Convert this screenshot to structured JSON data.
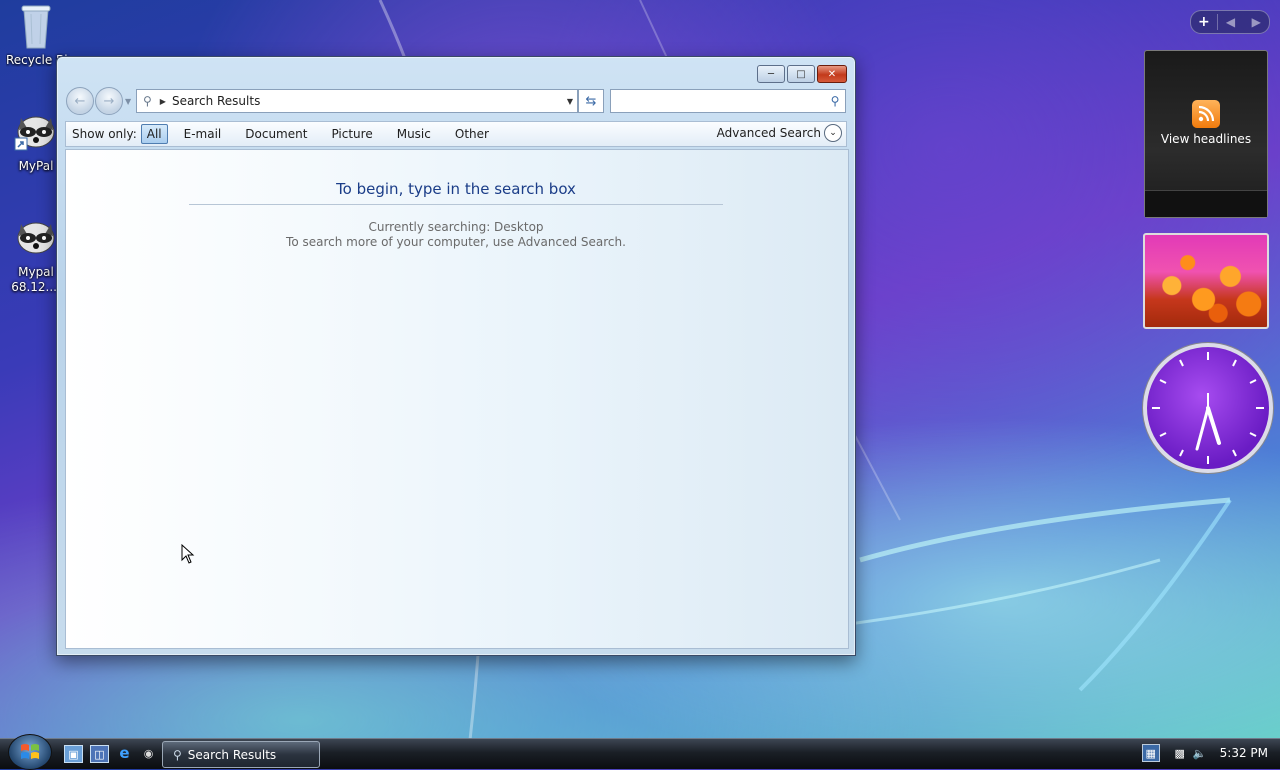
{
  "desktop": {
    "icons": [
      {
        "label": "Recycle Bin",
        "icon": "recycle-bin-icon"
      },
      {
        "label": "MyPal",
        "icon": "raccoon-icon"
      },
      {
        "label": "Mypal 68.12....",
        "icon": "raccoon-icon"
      }
    ]
  },
  "window": {
    "title": "Search Results",
    "caption_buttons": {
      "minimize": "minimize-icon",
      "maximize": "maximize-icon",
      "close": "close-icon"
    },
    "address": {
      "text": "Search Results"
    },
    "search": {
      "value": "",
      "placeholder": ""
    },
    "filter": {
      "label": "Show only:",
      "options": [
        "All",
        "E-mail",
        "Document",
        "Picture",
        "Music",
        "Other"
      ],
      "active": "All",
      "advanced_label": "Advanced Search"
    },
    "content": {
      "heading": "To begin, type in the search box",
      "line1": "Currently searching: Desktop",
      "line2": "To search more of your computer, use Advanced Search."
    }
  },
  "sidebar": {
    "feed_label": "View headlines",
    "clock_time": "5:32"
  },
  "taskbar": {
    "task_label": "Search Results",
    "clock": "5:32 PM"
  },
  "colors": {
    "heading": "#1b3d88",
    "accent": "#3b6aa6"
  }
}
